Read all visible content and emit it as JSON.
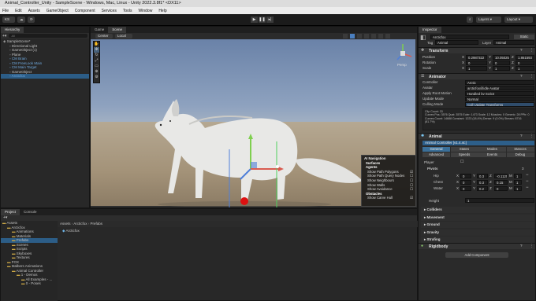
{
  "window": {
    "title": "Animal_Controller_Unity - SampleScene - Windows, Mac, Linux - Unity 2022.3.8f1* <DX11>"
  },
  "menu": [
    "File",
    "Edit",
    "Assets",
    "GameObject",
    "Component",
    "Services",
    "Tools",
    "Window",
    "Help"
  ],
  "toolbar": {
    "account": "KS",
    "layers": "Layers",
    "layout": "Layout"
  },
  "hierarchy": {
    "tab": "Hierarchy",
    "search_placeholder": "All",
    "items": [
      {
        "label": "SampleScene*",
        "indent": 0,
        "sel": false
      },
      {
        "label": "Directional Light",
        "indent": 1,
        "sel": false
      },
      {
        "label": "GameObject (1)",
        "indent": 1,
        "sel": false
      },
      {
        "label": "Plane",
        "indent": 1,
        "sel": false
      },
      {
        "label": "CM Brain",
        "indent": 1,
        "sel": false,
        "blue": true
      },
      {
        "label": "CM FreeLook Main",
        "indent": 1,
        "sel": false,
        "blue": true
      },
      {
        "label": "CM Main Target",
        "indent": 1,
        "sel": false,
        "blue": true
      },
      {
        "label": "GameObject",
        "indent": 1,
        "sel": false
      },
      {
        "label": "Arcticfox",
        "indent": 1,
        "sel": true,
        "blue": true
      }
    ]
  },
  "scene": {
    "tabs": [
      "Game",
      "Scene"
    ],
    "active_tab": "Scene",
    "toolbar_left": [
      "Center",
      "Local"
    ],
    "persp_label": "Persp"
  },
  "ai_navigation": {
    "title": "AI Navigation",
    "sections": [
      {
        "header": "Surfaces",
        "items": []
      },
      {
        "header": "Agents",
        "items": [
          "Show Path Polygons",
          "Show Path Query Nodes",
          "Show Neighbours",
          "Show Walls",
          "Show Avoidance"
        ]
      },
      {
        "header": "Obstacles",
        "items": [
          "Show Carve Hull"
        ]
      }
    ]
  },
  "project": {
    "tabs": [
      "Project",
      "Console"
    ],
    "breadcrumb": [
      "Assets",
      "Arcticfox",
      "Prefabs"
    ],
    "tree": [
      {
        "label": "Assets",
        "indent": 0
      },
      {
        "label": "Arcticfox",
        "indent": 1
      },
      {
        "label": "Animations",
        "indent": 2
      },
      {
        "label": "Materials",
        "indent": 2
      },
      {
        "label": "Prefabs",
        "indent": 2,
        "sel": true
      },
      {
        "label": "Scenes",
        "indent": 2
      },
      {
        "label": "Scripts",
        "indent": 2
      },
      {
        "label": "Skyboxes",
        "indent": 2
      },
      {
        "label": "Textures",
        "indent": 2
      },
      {
        "label": "FOX",
        "indent": 1
      },
      {
        "label": "Malbers Animations",
        "indent": 1
      },
      {
        "label": "Animal Controller",
        "indent": 2
      },
      {
        "label": "1 - Demos",
        "indent": 3
      },
      {
        "label": "All Examples - ...",
        "indent": 4
      },
      {
        "label": "0 - Poses",
        "indent": 4
      }
    ],
    "file": "Arcticfox"
  },
  "inspector": {
    "tab": "Inspector",
    "object_name": "Arcticfox",
    "static_label": "Static",
    "tag_label": "Tag",
    "tag_value": "Animal",
    "layer_label": "Layer",
    "layer_value": "Animal",
    "transform": {
      "title": "Transform",
      "rows": [
        {
          "label": "Position",
          "x": "0.2987322",
          "y": "10.05025",
          "z": "1.861593"
        },
        {
          "label": "Rotation",
          "x": "0",
          "y": "0",
          "z": "0"
        },
        {
          "label": "Scale",
          "x": "1",
          "y": "1",
          "z": "1"
        }
      ]
    },
    "animator": {
      "title": "Animator",
      "rows": [
        {
          "label": "Controller",
          "value": "Arctic"
        },
        {
          "label": "Avatar",
          "value": "arcticfox@idle Avatar"
        },
        {
          "label": "Apply Root Motion",
          "value": "Handled by Script"
        },
        {
          "label": "Update Mode",
          "value": "Normal"
        },
        {
          "label": "Culling Mode",
          "value": "Cull Update Transforms"
        }
      ],
      "info": "Clip Count: 33\nCurves Pos: 3576 Quat: 3575 Euler: 1473 Scale: 12 Muscles: 0 Generic: 28 PPtr: 0\nCurves Count: 14688 Constant: 1223 (18.4%) Dense: 9 (0.0%) Stream: 8716 (81.7%)"
    },
    "animal": {
      "title": "Animal",
      "subtitle": "Animal Controller [v1.4.4c]",
      "tabs_row1": [
        "General",
        "States",
        "Modes",
        "Stances"
      ],
      "tabs_row2": [
        "Advanced",
        "Speeds",
        "Events",
        "Debug"
      ],
      "player_label": "Player",
      "pivots_label": "Pivots",
      "pivots_count": "3",
      "pivots": [
        {
          "name": "Hip",
          "x": "0",
          "y": "0.3",
          "z": "-0.1125",
          "m": "1"
        },
        {
          "name": "Chest",
          "x": "0",
          "y": "0.3",
          "z": "0.15",
          "m": "1"
        },
        {
          "name": "Water",
          "x": "0",
          "y": "0.2",
          "z": "0",
          "m": "1"
        }
      ],
      "height_label": "Height",
      "height_value": "1",
      "foldouts": [
        "Colliders",
        "Movement",
        "Ground",
        "Gravity",
        "Strafing"
      ]
    },
    "rigidbody": {
      "title": "Rigidbody"
    },
    "add_component": "Add Component"
  }
}
